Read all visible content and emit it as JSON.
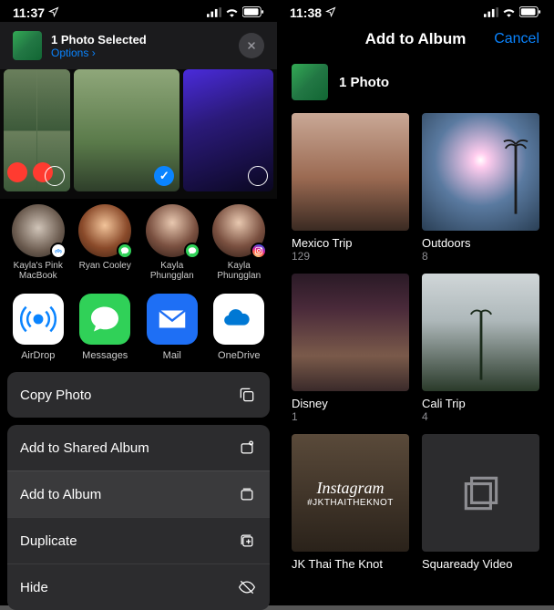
{
  "left": {
    "status": {
      "time": "11:37",
      "loc_icon": "location-arrow",
      "signal": 4,
      "wifi": 3,
      "battery": 85
    },
    "header": {
      "title": "1 Photo Selected",
      "options_label": "Options",
      "chevron": "›"
    },
    "photos": [
      {
        "id": "p1",
        "selected": false
      },
      {
        "id": "p2",
        "selected": true
      },
      {
        "id": "p3",
        "selected": false
      }
    ],
    "share_targets": [
      {
        "label": "Kayla's Pink MacBook",
        "badge": "airdrop"
      },
      {
        "label": "Ryan Cooley",
        "badge": "messages"
      },
      {
        "label": "Kayla Phungglan",
        "badge": "messages"
      },
      {
        "label": "Kayla Phungglan",
        "badge": "instagram"
      }
    ],
    "app_targets": [
      {
        "label": "AirDrop",
        "icon": "airdrop"
      },
      {
        "label": "Messages",
        "icon": "messages"
      },
      {
        "label": "Mail",
        "icon": "mail"
      },
      {
        "label": "OneDrive",
        "icon": "onedrive"
      }
    ],
    "actions": {
      "copy": "Copy Photo",
      "group": [
        {
          "label": "Add to Shared Album",
          "icon": "shared-album"
        },
        {
          "label": "Add to Album",
          "icon": "album",
          "highlight": true
        },
        {
          "label": "Duplicate",
          "icon": "duplicate"
        },
        {
          "label": "Hide",
          "icon": "hide"
        }
      ]
    }
  },
  "right": {
    "status": {
      "time": "11:38",
      "loc_icon": "location-arrow",
      "signal": 4,
      "wifi": 3,
      "battery": 85
    },
    "nav": {
      "title": "Add to Album",
      "cancel": "Cancel"
    },
    "selected": {
      "count_label": "1 Photo"
    },
    "albums": [
      {
        "name": "Mexico Trip",
        "count": "129",
        "cover": "mexico"
      },
      {
        "name": "Outdoors",
        "count": "8",
        "cover": "outdoors"
      },
      {
        "name": "Disney",
        "count": "1",
        "cover": "disney"
      },
      {
        "name": "Cali Trip",
        "count": "4",
        "cover": "cali"
      },
      {
        "name": "JK Thai The Knot",
        "count": "",
        "cover": "insta",
        "overlay_script": "Instagram",
        "overlay_hash": "#JKTHAITHEKNOT"
      },
      {
        "name": "Squaready Video",
        "count": "",
        "cover": "square"
      }
    ]
  }
}
